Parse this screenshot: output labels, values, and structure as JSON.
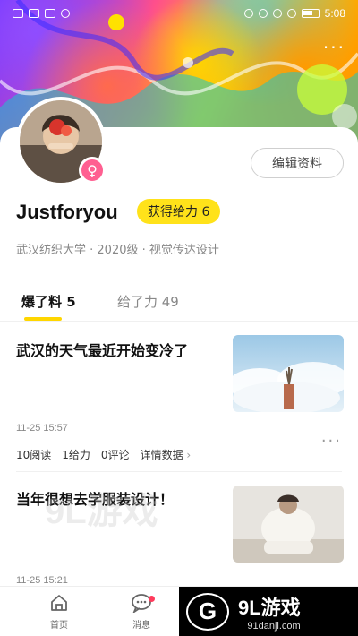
{
  "status_bar": {
    "time": "5:08",
    "icons_left": [
      "signal-icon",
      "wifi-icon",
      "signal-icon",
      "app-icon"
    ],
    "icons_right": [
      "headset-icon",
      "alarm-icon",
      "bluetooth-icon",
      "mute-icon",
      "battery-icon"
    ]
  },
  "header": {
    "more_label": "···"
  },
  "profile": {
    "username": "Justforyou",
    "power_badge": "获得给力 6",
    "bio": "武汉纺织大学 · 2020级 · 视觉传达设计",
    "edit_button": "编辑资料",
    "gender_symbol": "♀",
    "gender_color": "#ff5f91"
  },
  "tabs": [
    {
      "label": "爆了料 5",
      "active": true
    },
    {
      "label": "给了力 49",
      "active": false
    }
  ],
  "posts": [
    {
      "title": "武汉的天气最近开始变冷了",
      "time": "11-25 15:57",
      "stats": [
        "10阅读",
        "1给力",
        "0评论"
      ],
      "detail_label": "详情数据",
      "more_label": "···"
    },
    {
      "title": "当年很想去学服装设计！",
      "time": "11-25 15:21"
    }
  ],
  "bottom_nav": [
    {
      "label": "首页",
      "icon": "home-icon"
    },
    {
      "label": "消息",
      "icon": "chat-icon"
    }
  ],
  "watermark": {
    "brand": "9L游戏",
    "url": "91danji.com",
    "logo_text": "G"
  },
  "colors": {
    "accent": "#ffd600",
    "badge_bg": "#ffe21a"
  }
}
